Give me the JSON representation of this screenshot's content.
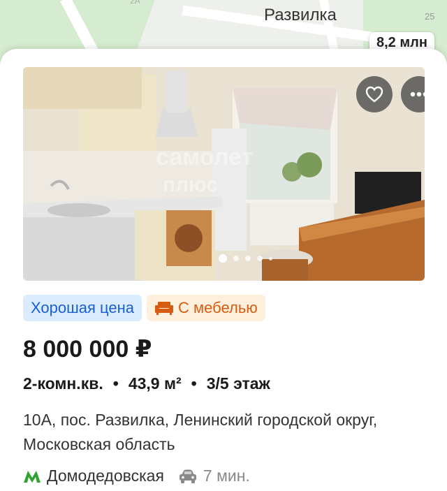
{
  "map": {
    "town": "Развилка",
    "road_number": "25",
    "road_number_top": "2А",
    "price_pin": "8,2 млн"
  },
  "listing": {
    "photo": {
      "watermark": "самолет плюс",
      "slide_count": 5,
      "active_slide": 1
    },
    "tags": {
      "good_price": "Хорошая цена",
      "furnished": "С мебелью"
    },
    "price": "8 000 000 ₽",
    "params": {
      "rooms": "2-комн.кв.",
      "separator": "•",
      "area": "43,9 м²",
      "floor": "3/5 этаж"
    },
    "address": "10А, пос. Развилка, Ленинский городской округ, Московская область",
    "metro": {
      "station": "Домодедовская",
      "time": "7 мин."
    }
  },
  "colors": {
    "good_price_bg": "#dcecff",
    "good_price_text": "#1a5fd0",
    "furnished_bg": "#fff0dd",
    "furnished_text": "#d65c12",
    "metro_line": "#2fa32f"
  },
  "icons": [
    "heart-icon",
    "more-dots-icon",
    "sofa-icon",
    "metro-icon",
    "car-icon"
  ]
}
